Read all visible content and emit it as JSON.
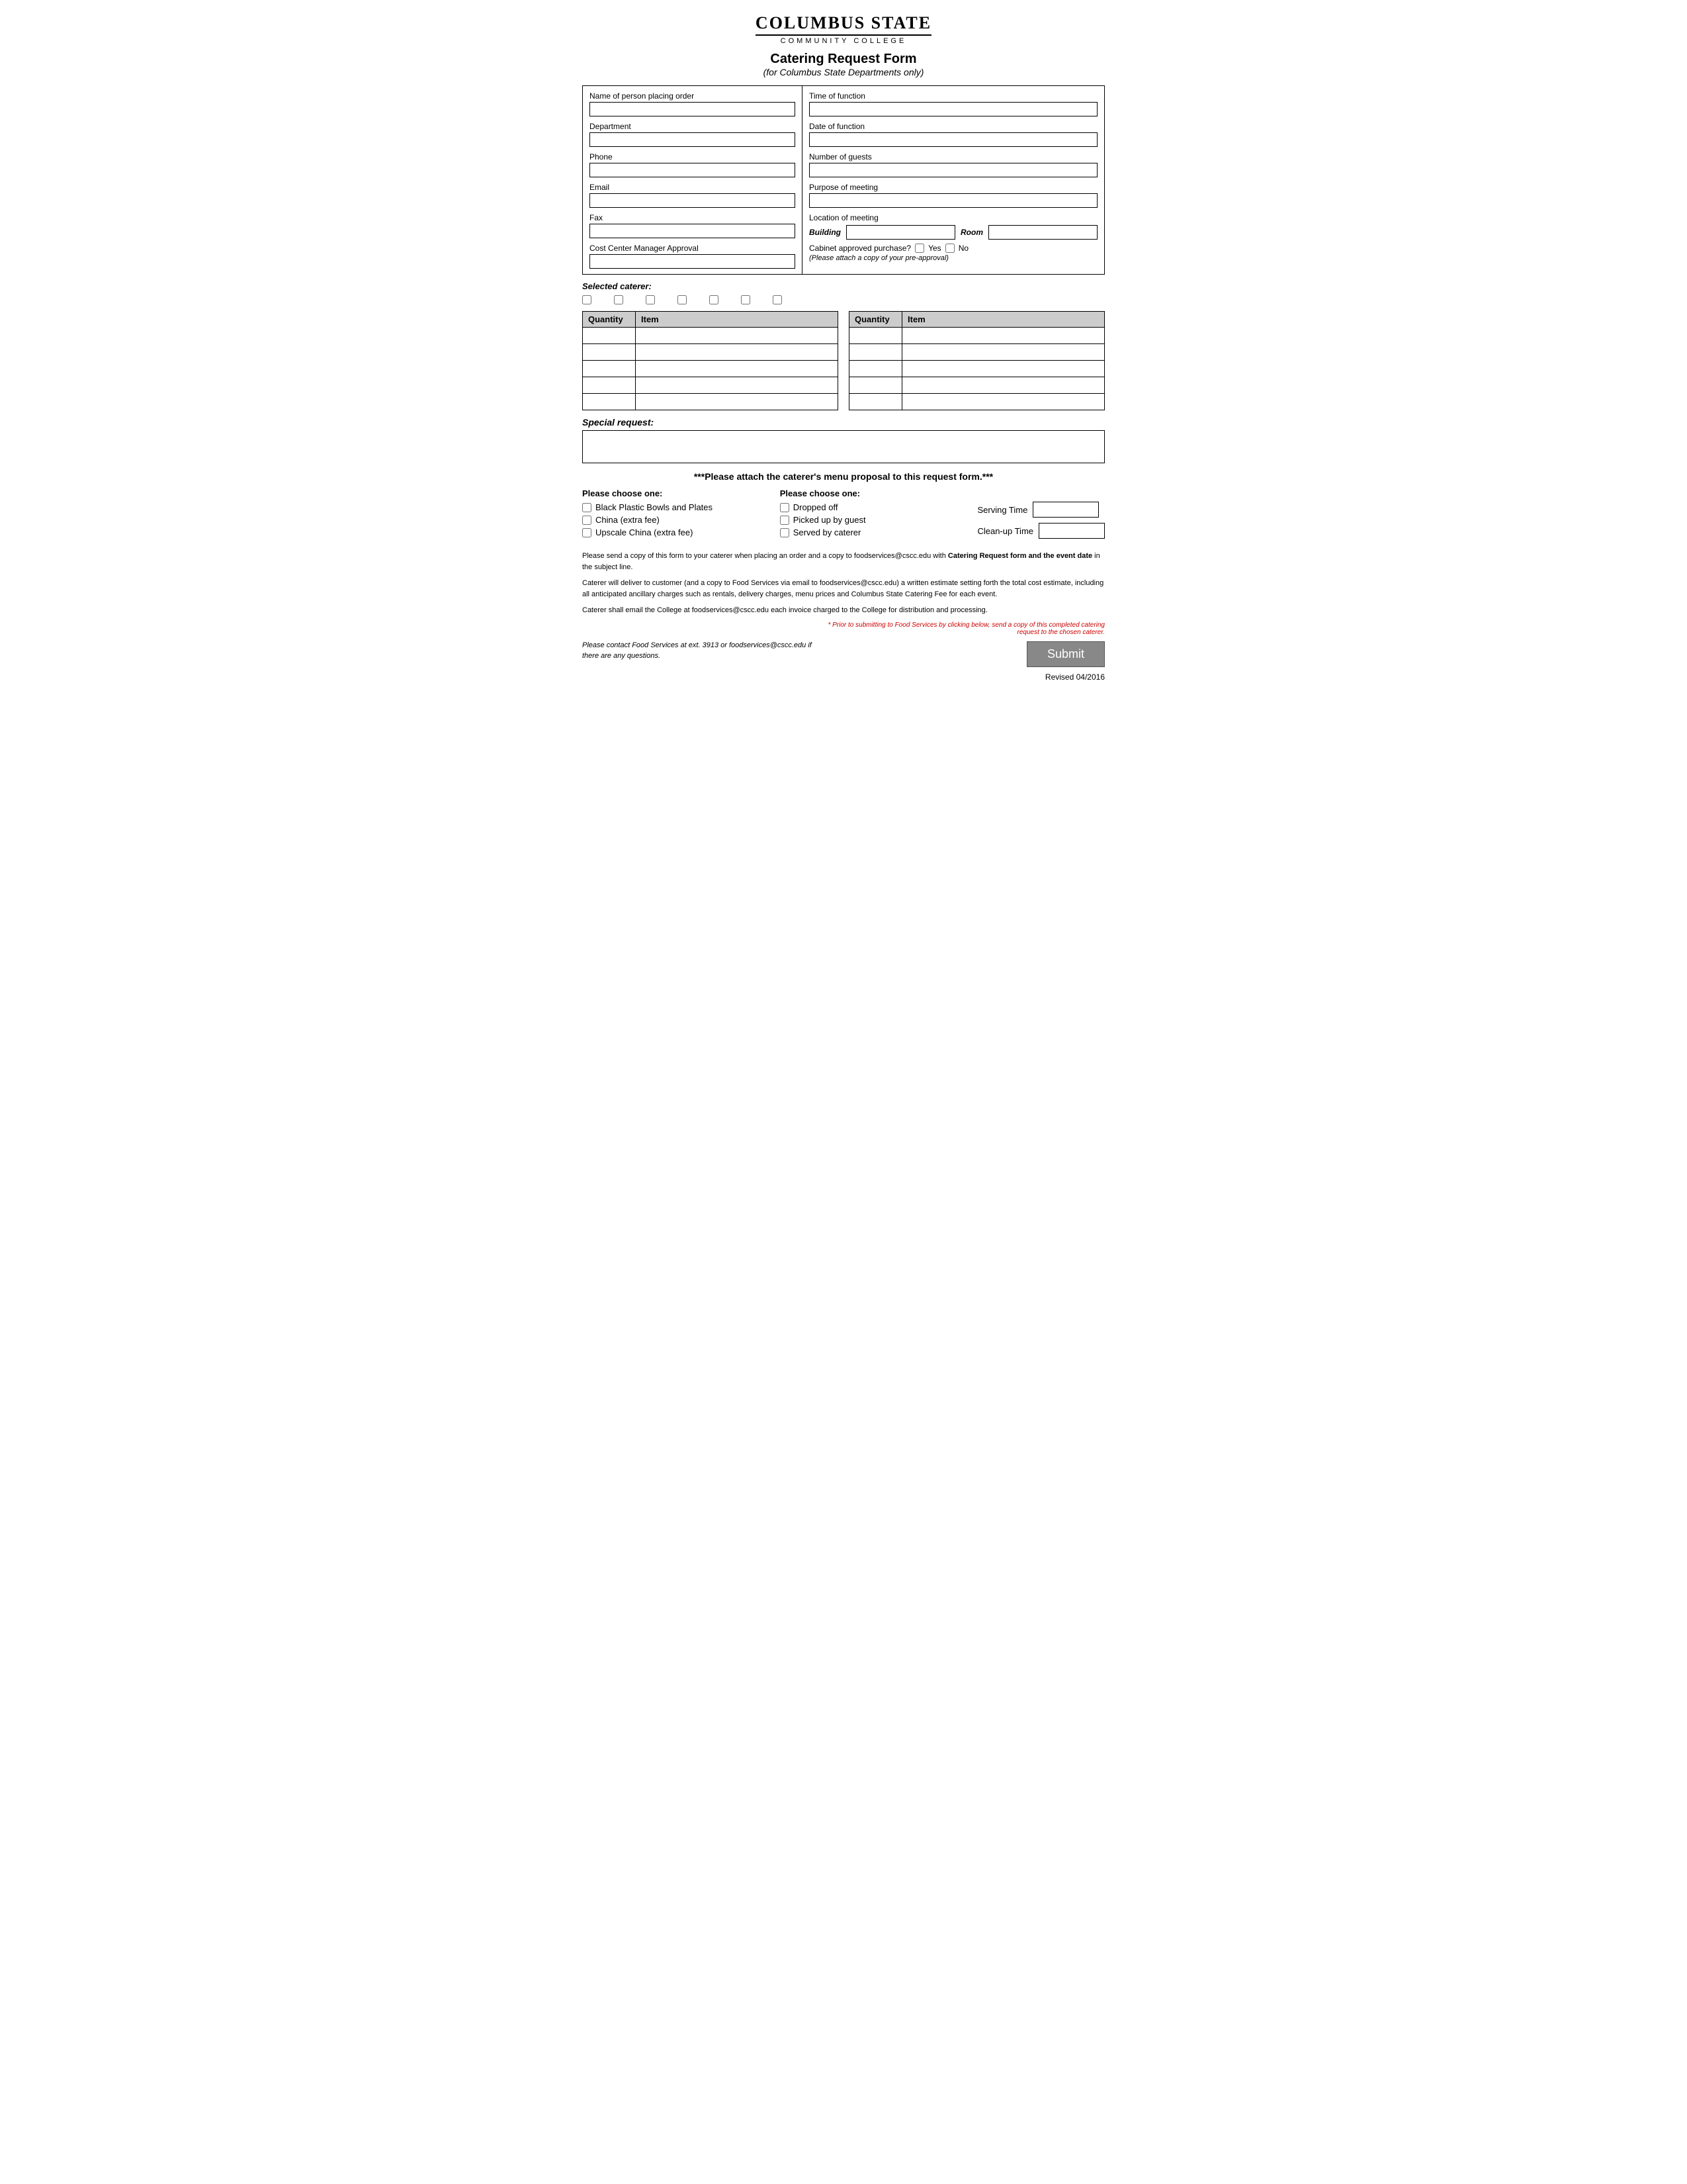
{
  "header": {
    "school_name": "Columbus State",
    "college_name": "Community College",
    "form_title": "Catering Request Form",
    "form_subtitle": "(for Columbus State Departments only)"
  },
  "left_fields": {
    "name_label": "Name of person placing order",
    "department_label": "Department",
    "phone_label": "Phone",
    "email_label": "Email",
    "fax_label": "Fax",
    "cost_center_label": "Cost Center Manager Approval"
  },
  "right_fields": {
    "time_label": "Time of function",
    "date_label": "Date of function",
    "guests_label": "Number of guests",
    "purpose_label": "Purpose of meeting",
    "location_label": "Location of meeting",
    "building_label": "Building",
    "room_label": "Room",
    "cabinet_label": "Cabinet approved purchase?",
    "yes_label": "Yes",
    "no_label": "No",
    "cabinet_note": "(Please attach a copy of your pre-approval)"
  },
  "caterer": {
    "label": "Selected caterer:",
    "options": [
      "",
      "",
      "",
      "",
      "",
      "",
      ""
    ]
  },
  "tables": {
    "qty_header": "Quantity",
    "item_header": "Item",
    "rows": 5
  },
  "special_request": {
    "label": "Special request:"
  },
  "attach_note": "***Please attach the caterer's menu proposal to this request form.***",
  "choose_one_left": {
    "title": "Please choose one:",
    "options": [
      "Black Plastic Bowls and Plates",
      "China (extra fee)",
      "Upscale China (extra fee)"
    ]
  },
  "choose_one_right": {
    "title": "Please choose one:",
    "options": [
      "Dropped off",
      "Picked up by guest",
      "Served by caterer"
    ]
  },
  "serving": {
    "serving_time_label": "Serving Time",
    "cleanup_time_label": "Clean-up Time"
  },
  "info_paragraphs": [
    "Please send a copy of this form to your caterer when placing an order and a copy to foodservices@cscc.edu with Catering Request form and the event date in the subject line.",
    "Caterer will deliver to customer (and a copy to Food Services via email to foodservices@cscc.edu) a written estimate setting forth the total cost estimate, including all anticipated ancillary charges such as rentals, delivery charges, menu prices and Columbus State Catering Fee for each event.",
    "Caterer shall email the College at foodservices@cscc.edu each invoice charged to the College for distribution and processing."
  ],
  "info_bold": "Catering Request form and the event date",
  "red_note": "* Prior to submitting to Food Services by clicking below, send a copy of this completed catering request to the chosen caterer.",
  "footer_note": "Please contact Food Services at ext. 3913 or foodservices@cscc.edu if there are any questions.",
  "submit_label": "Submit",
  "revised": "Revised 04/2016"
}
